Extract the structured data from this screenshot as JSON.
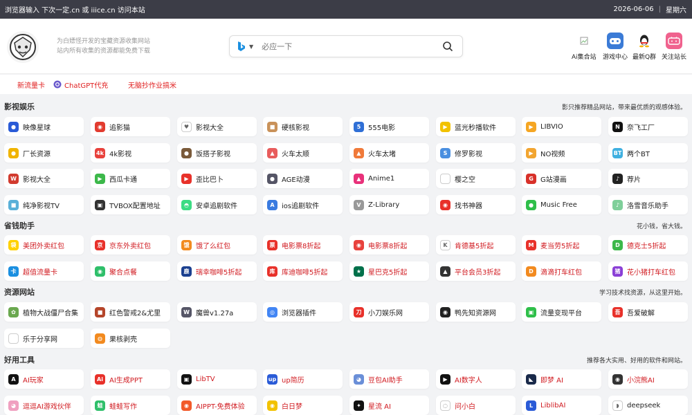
{
  "topbar": {
    "notice": "浏览器输入 下次一定.cn 或 iiice.cn 访问本站",
    "date": "2026-06-06",
    "weekday": "星期六"
  },
  "header": {
    "slogan_line1": "为白嫖怪开发的宝藏资源收集网站",
    "slogan_line2": "站内所有收集的资源都能免费下载",
    "search_placeholder": "必应一下",
    "quick_links": [
      {
        "label": "Ai集合站",
        "icon": "broken-image-icon",
        "color": "#ffffff"
      },
      {
        "label": "游戏中心",
        "icon": "gamepad-icon",
        "color": "#3b7bd6"
      },
      {
        "label": "最新Q群",
        "icon": "qq-penguin-icon",
        "color": "#222222"
      },
      {
        "label": "关注站长",
        "icon": "bilibili-icon",
        "color": "#f0628e"
      }
    ]
  },
  "hotlinks": [
    {
      "label": "新流量卡",
      "icon": ""
    },
    {
      "label": "ChatGPT代充",
      "icon": "chatgpt-icon"
    },
    {
      "label": "无脑抄作业搞米",
      "icon": ""
    }
  ],
  "sections": [
    {
      "title": "影视娱乐",
      "desc": "影只推荐精品网站，带来最优质的观感体验。",
      "rows": [
        [
          {
            "label": "映像星球",
            "color": "#2a5bd7",
            "glyph": "●",
            "red": false
          },
          {
            "label": "追影猫",
            "color": "#e23b2f",
            "glyph": "◉",
            "red": false
          },
          {
            "label": "影视大全",
            "color": "#ffffff",
            "glyph": "♥",
            "red": false
          },
          {
            "label": "硬核影视",
            "color": "#c9925a",
            "glyph": "■",
            "red": false
          },
          {
            "label": "555电影",
            "color": "#2f6fd6",
            "glyph": "5",
            "red": false
          },
          {
            "label": "蓝光秒播软件",
            "color": "#f2c200",
            "glyph": "▶",
            "red": false
          },
          {
            "label": "LIBVIO",
            "color": "#f5a623",
            "glyph": "▶",
            "red": false
          },
          {
            "label": "奈飞工厂",
            "color": "#111111",
            "glyph": "N",
            "red": false
          }
        ],
        [
          {
            "label": "厂长资源",
            "color": "#f0b400",
            "glyph": "●",
            "red": false
          },
          {
            "label": "4k影视",
            "color": "#e8413c",
            "glyph": "4k",
            "red": false
          },
          {
            "label": "饭搭子影视",
            "color": "#7a5a3a",
            "glyph": "●",
            "red": false
          },
          {
            "label": "火车太顺",
            "color": "#e85c5c",
            "glyph": "▲",
            "red": false
          },
          {
            "label": "火车太堵",
            "color": "#f07a3a",
            "glyph": "▲",
            "red": false
          },
          {
            "label": "修罗影视",
            "color": "#4a8fe0",
            "glyph": "S",
            "red": false
          },
          {
            "label": "NO视频",
            "color": "#f2a530",
            "glyph": "▶",
            "red": false
          },
          {
            "label": "两个BT",
            "color": "#3fb0e0",
            "glyph": "BT",
            "red": false
          }
        ],
        [
          {
            "label": "影视大全",
            "color": "#d23b2f",
            "glyph": "W",
            "red": false
          },
          {
            "label": "西瓜卡通",
            "color": "#3cb84a",
            "glyph": "▶",
            "red": false
          },
          {
            "label": "歪比巴卜",
            "color": "#e8312a",
            "glyph": "▶",
            "red": false
          },
          {
            "label": "AGE动漫",
            "color": "#555566",
            "glyph": "●",
            "red": false
          },
          {
            "label": "Anime1",
            "color": "#e8317a",
            "glyph": "▲",
            "red": false
          },
          {
            "label": "樱之空",
            "color": "#ffffff",
            "glyph": "",
            "red": false
          },
          {
            "label": "G站漫画",
            "color": "#d8312a",
            "glyph": "G",
            "red": false
          },
          {
            "label": "荐片",
            "color": "#222222",
            "glyph": "♪",
            "red": false
          }
        ],
        [
          {
            "label": "纯净影视TV",
            "color": "#5ab0d8",
            "glyph": "■",
            "red": false
          },
          {
            "label": "TVBOX配置地址",
            "color": "#333333",
            "glyph": "▣",
            "red": false
          },
          {
            "label": "安卓追剧软件",
            "color": "#3ddc84",
            "glyph": "◓",
            "red": false
          },
          {
            "label": "ios追剧软件",
            "color": "#3a7be0",
            "glyph": "A",
            "red": false
          },
          {
            "label": "Z-Library",
            "color": "#999999",
            "glyph": "V",
            "red": false
          },
          {
            "label": "找书神器",
            "color": "#e8312a",
            "glyph": "◉",
            "red": false
          },
          {
            "label": "Music Free",
            "color": "#2fbf4a",
            "glyph": "●",
            "red": false
          },
          {
            "label": "洛雪音乐助手",
            "color": "#7fcf9a",
            "glyph": "♪",
            "red": false
          }
        ]
      ]
    },
    {
      "title": "省钱助手",
      "desc": "花小钱，省大钱。",
      "rows": [
        [
          {
            "label": "美团外卖红包",
            "color": "#ffd100",
            "glyph": "袋",
            "red": true
          },
          {
            "label": "京东外卖红包",
            "color": "#e8312a",
            "glyph": "京",
            "red": true
          },
          {
            "label": "饿了么红包",
            "color": "#f28a1f",
            "glyph": "饿",
            "red": true
          },
          {
            "label": "电影票8折起",
            "color": "#e8312a",
            "glyph": "票",
            "red": true
          },
          {
            "label": "电影票8折起",
            "color": "#e8413c",
            "glyph": "◉",
            "red": true
          },
          {
            "label": "肯德基5折起",
            "color": "#ffffff",
            "glyph": "K",
            "red": true
          },
          {
            "label": "麦当劳5折起",
            "color": "#e8312a",
            "glyph": "M",
            "red": true
          },
          {
            "label": "德克士5折起",
            "color": "#3cb84a",
            "glyph": "D",
            "red": true
          }
        ],
        [
          {
            "label": "超值流量卡",
            "color": "#1a8fe0",
            "glyph": "卡",
            "red": true
          },
          {
            "label": "聚合点餐",
            "color": "#2fbf6a",
            "glyph": "◉",
            "red": true
          },
          {
            "label": "瑞幸咖啡5折起",
            "color": "#1a3f8f",
            "glyph": "鹿",
            "red": true
          },
          {
            "label": "库迪咖啡5折起",
            "color": "#e8312a",
            "glyph": "库",
            "red": true
          },
          {
            "label": "星巴克5折起",
            "color": "#00704a",
            "glyph": "★",
            "red": true
          },
          {
            "label": "平台会员3折起",
            "color": "#333333",
            "glyph": "▲",
            "red": true
          },
          {
            "label": "滴滴打车红包",
            "color": "#f28a1f",
            "glyph": "D",
            "red": true
          },
          {
            "label": "花小猪打车红包",
            "color": "#8a3fd6",
            "glyph": "猪",
            "red": true
          }
        ]
      ]
    },
    {
      "title": "资源网站",
      "desc": "学习技术找资源，从这里开始。",
      "rows": [
        [
          {
            "label": "植物大战僵尸合集",
            "color": "#6aa84f",
            "glyph": "✿",
            "red": false
          },
          {
            "label": "红色警戒2&尤里",
            "color": "#b5452a",
            "glyph": "■",
            "red": false
          },
          {
            "label": "魔兽v1.27a",
            "color": "#555566",
            "glyph": "W",
            "red": false
          },
          {
            "label": "浏览器插件",
            "color": "#4285f4",
            "glyph": "◎",
            "red": false
          },
          {
            "label": "小刀娱乐网",
            "color": "#e8312a",
            "glyph": "刀",
            "red": false
          },
          {
            "label": "鸭先知资源网",
            "color": "#222222",
            "glyph": "◉",
            "red": false
          },
          {
            "label": "流量变现平台",
            "color": "#2fbf4a",
            "glyph": "▣",
            "red": false
          },
          {
            "label": "吾爱破解",
            "color": "#e8312a",
            "glyph": "吾",
            "red": false
          }
        ],
        [
          {
            "label": "乐于分享网",
            "color": "#ffffff",
            "glyph": "",
            "red": false
          },
          {
            "label": "果核剥壳",
            "color": "#f28a1f",
            "glyph": "◍",
            "red": false
          }
        ]
      ]
    },
    {
      "title": "好用工具",
      "desc": "推荐各大实用、好用的软件和网站。",
      "rows": [
        [
          {
            "label": "AI玩家",
            "color": "#111111",
            "glyph": "A",
            "red": true
          },
          {
            "label": "AI生成PPT",
            "color": "#e8312a",
            "glyph": "Ai",
            "red": true
          },
          {
            "label": "LibTV",
            "color": "#111111",
            "glyph": "▣",
            "red": true
          },
          {
            "label": "up简历",
            "color": "#2a5bd7",
            "glyph": "up",
            "red": true
          },
          {
            "label": "豆包AI助手",
            "color": "#6a8fd8",
            "glyph": "◕",
            "red": true
          },
          {
            "label": "AI数字人",
            "color": "#111111",
            "glyph": "▶",
            "red": true
          },
          {
            "label": "即梦 AI",
            "color": "#1a2a4a",
            "glyph": "◣",
            "red": true
          },
          {
            "label": "小浣熊AI",
            "color": "#333333",
            "glyph": "◉",
            "red": true
          }
        ],
        [
          {
            "label": "逗逗AI游戏伙伴",
            "color": "#f0a0c0",
            "glyph": "◕",
            "red": true
          },
          {
            "label": "蛙蛙写作",
            "color": "#2fbf6a",
            "glyph": "蛙",
            "red": true
          },
          {
            "label": "AIPPT-免费体验",
            "color": "#f25a2a",
            "glyph": "◉",
            "red": true
          },
          {
            "label": "白日梦",
            "color": "#f2c200",
            "glyph": "◉",
            "red": true
          },
          {
            "label": "星流 AI",
            "color": "#111111",
            "glyph": "✦",
            "red": true
          },
          {
            "label": "问小白",
            "color": "#ffffff",
            "glyph": "◌",
            "red": true
          },
          {
            "label": "LiblibAI",
            "color": "#2a5bd7",
            "glyph": "L",
            "red": true
          },
          {
            "label": "deepseek",
            "color": "#ffffff",
            "glyph": "◗",
            "red": false
          }
        ]
      ]
    }
  ]
}
